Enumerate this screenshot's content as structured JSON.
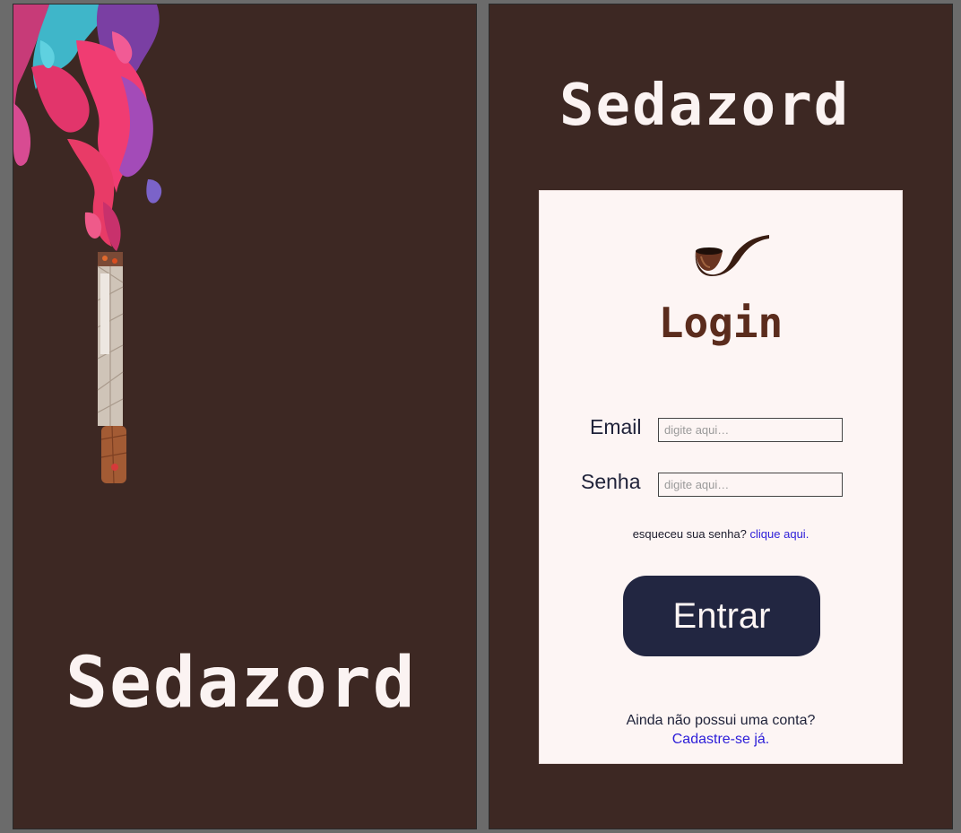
{
  "splash": {
    "brand": "Sedazord",
    "illustration_icon": "lit-cigarette-with-colorful-smoke"
  },
  "login": {
    "brand": "Sedazord",
    "pipe_icon": "tobacco-pipe-icon",
    "title": "Login",
    "email_label": "Email",
    "email_placeholder": "digite aqui…",
    "password_label": "Senha",
    "password_placeholder": "digite aqui…",
    "forgot_text": "esqueceu sua senha?",
    "forgot_link": "clique aqui.",
    "enter_button": "Entrar",
    "no_account_text": "Ainda não possui uma conta?",
    "signup_link": "Cadastre-se já."
  },
  "colors": {
    "background_brown": "#3d2823",
    "card": "#fdf5f4",
    "title_brown": "#5b2c1d",
    "button_navy": "#222641",
    "link_blue": "#2c1dd8"
  }
}
